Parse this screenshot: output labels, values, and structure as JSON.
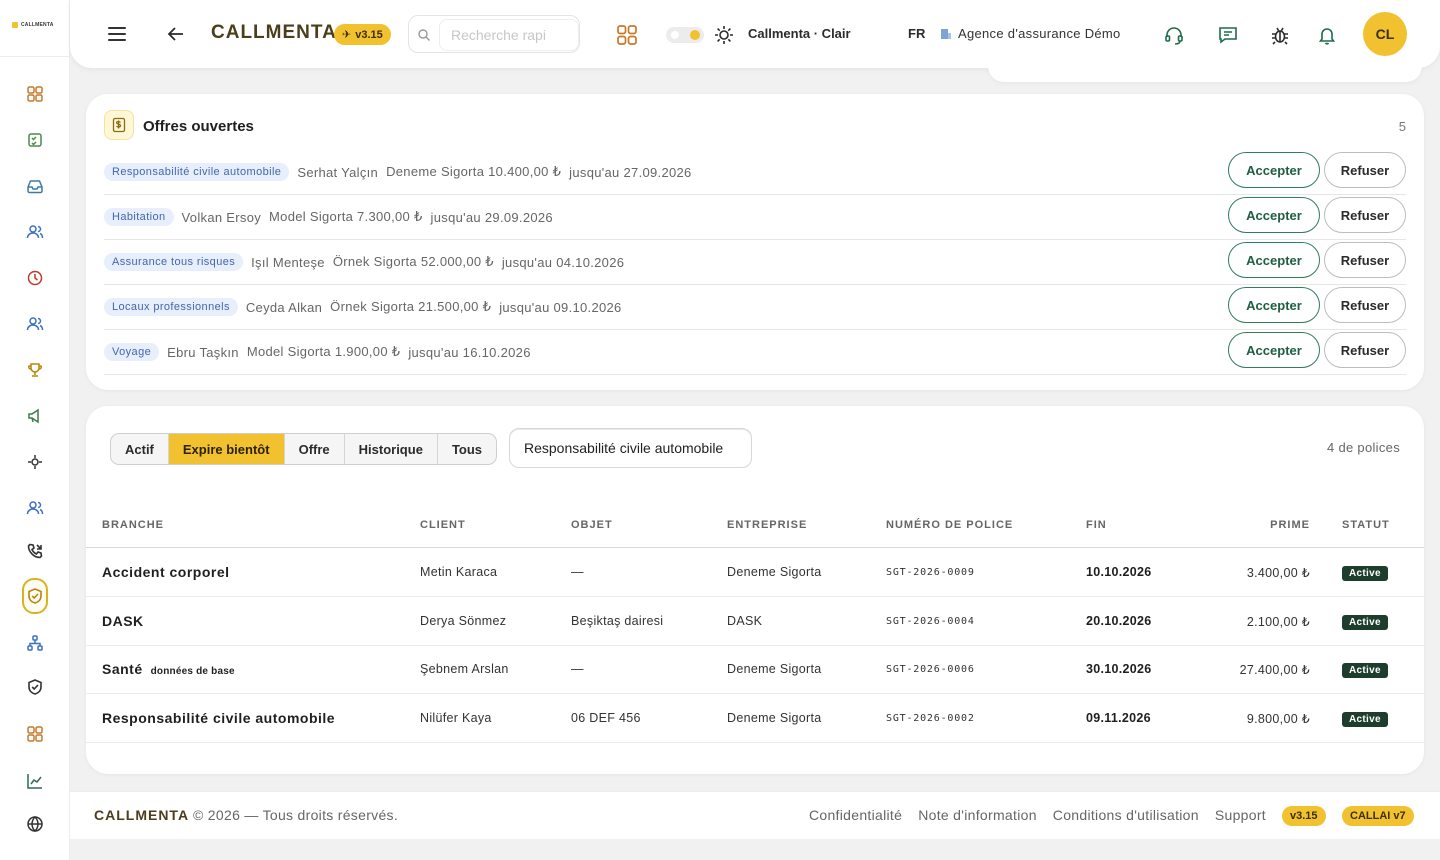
{
  "sidebar": {
    "logo_text": "CALLMENTA",
    "icons": [
      "dashboard-icon",
      "tasks-icon",
      "inbox-icon",
      "contacts-icon",
      "clock-icon",
      "team-icon",
      "trophy-icon",
      "megaphone-icon",
      "integrations-icon",
      "users-icon",
      "phone-icon",
      "policy-shield-icon",
      "org-chart-icon",
      "shield-check-icon",
      "modules-icon",
      "analytics-icon",
      "globe-icon"
    ],
    "active_icon": "policy-shield-icon"
  },
  "header": {
    "brand": "CALLMENTA",
    "version": "v3.15",
    "search_placeholder": "Recherche rapi",
    "theme_label": "Callmenta · Clair",
    "language": "FR",
    "agency": "Agence d'assurance Démo",
    "avatar_initials": "CL"
  },
  "offers": {
    "title": "Offres ouvertes",
    "count": "5",
    "accept_label": "Accepter",
    "refuse_label": "Refuser",
    "items": [
      {
        "tag": "Responsabilité civile automobile",
        "client": "Serhat Yalçın",
        "company_amount": "Deneme Sigorta 10.400,00 ₺",
        "until": "jusqu'au 27.09.2026"
      },
      {
        "tag": "Habitation",
        "client": "Volkan Ersoy",
        "company_amount": "Model Sigorta 7.300,00 ₺",
        "until": "jusqu'au 29.09.2026"
      },
      {
        "tag": "Assurance tous risques",
        "client": "Işıl Menteşe",
        "company_amount": "Örnek Sigorta 52.000,00 ₺",
        "until": "jusqu'au 04.10.2026"
      },
      {
        "tag": "Locaux professionnels",
        "client": "Ceyda Alkan",
        "company_amount": "Örnek Sigorta 21.500,00 ₺",
        "until": "jusqu'au 09.10.2026"
      },
      {
        "tag": "Voyage",
        "client": "Ebru Taşkın",
        "company_amount": "Model Sigorta 1.900,00 ₺",
        "until": "jusqu'au 16.10.2026"
      }
    ]
  },
  "policies": {
    "tabs": [
      "Actif",
      "Expire bientôt",
      "Offre",
      "Historique",
      "Tous"
    ],
    "selected_tab": "Expire bientôt",
    "filter": "Responsabilité civile automobile",
    "count": "4 de polices",
    "columns": {
      "branch": "BRANCHE",
      "client": "CLIENT",
      "object": "OBJET",
      "company": "ENTREPRISE",
      "policy_no": "NUMÉRO DE POLICE",
      "end": "FIN",
      "prime": "PRIME",
      "status": "STATUT"
    },
    "rows": [
      {
        "branch": "Accident corporel",
        "branch_sub": "",
        "client": "Metin Karaca",
        "object": "—",
        "company": "Deneme Sigorta",
        "policy_no": "SGT-2026-0009",
        "end": "10.10.2026",
        "prime": "3.400,00 ₺",
        "status": "Active"
      },
      {
        "branch": "DASK",
        "branch_sub": "",
        "client": "Derya Sönmez",
        "object": "Beşiktaş dairesi",
        "company": "DASK",
        "policy_no": "SGT-2026-0004",
        "end": "20.10.2026",
        "prime": "2.100,00 ₺",
        "status": "Active"
      },
      {
        "branch": "Santé",
        "branch_sub": "données de base",
        "client": "Şebnem Arslan",
        "object": "—",
        "company": "Deneme Sigorta",
        "policy_no": "SGT-2026-0006",
        "end": "30.10.2026",
        "prime": "27.400,00 ₺",
        "status": "Active"
      },
      {
        "branch": "Responsabilité civile automobile",
        "branch_sub": "",
        "client": "Nilüfer Kaya",
        "object": "06 DEF 456",
        "company": "Deneme Sigorta",
        "policy_no": "SGT-2026-0002",
        "end": "09.11.2026",
        "prime": "9.800,00 ₺",
        "status": "Active"
      }
    ]
  },
  "footer": {
    "brand": "CALLMENTA",
    "copyright": "© 2026 — Tous droits réservés.",
    "links": [
      "Confidentialité",
      "Note d'information",
      "Conditions d'utilisation",
      "Support"
    ],
    "version": "v3.15",
    "ai_badge": "CALLAI v7"
  },
  "colors": {
    "accent": "#f2c130",
    "accept_green": "#2f7d5a",
    "status_badge": "#1d3d2d",
    "tag_blue_bg": "#e7eefc",
    "tag_blue_text": "#4466b0"
  }
}
